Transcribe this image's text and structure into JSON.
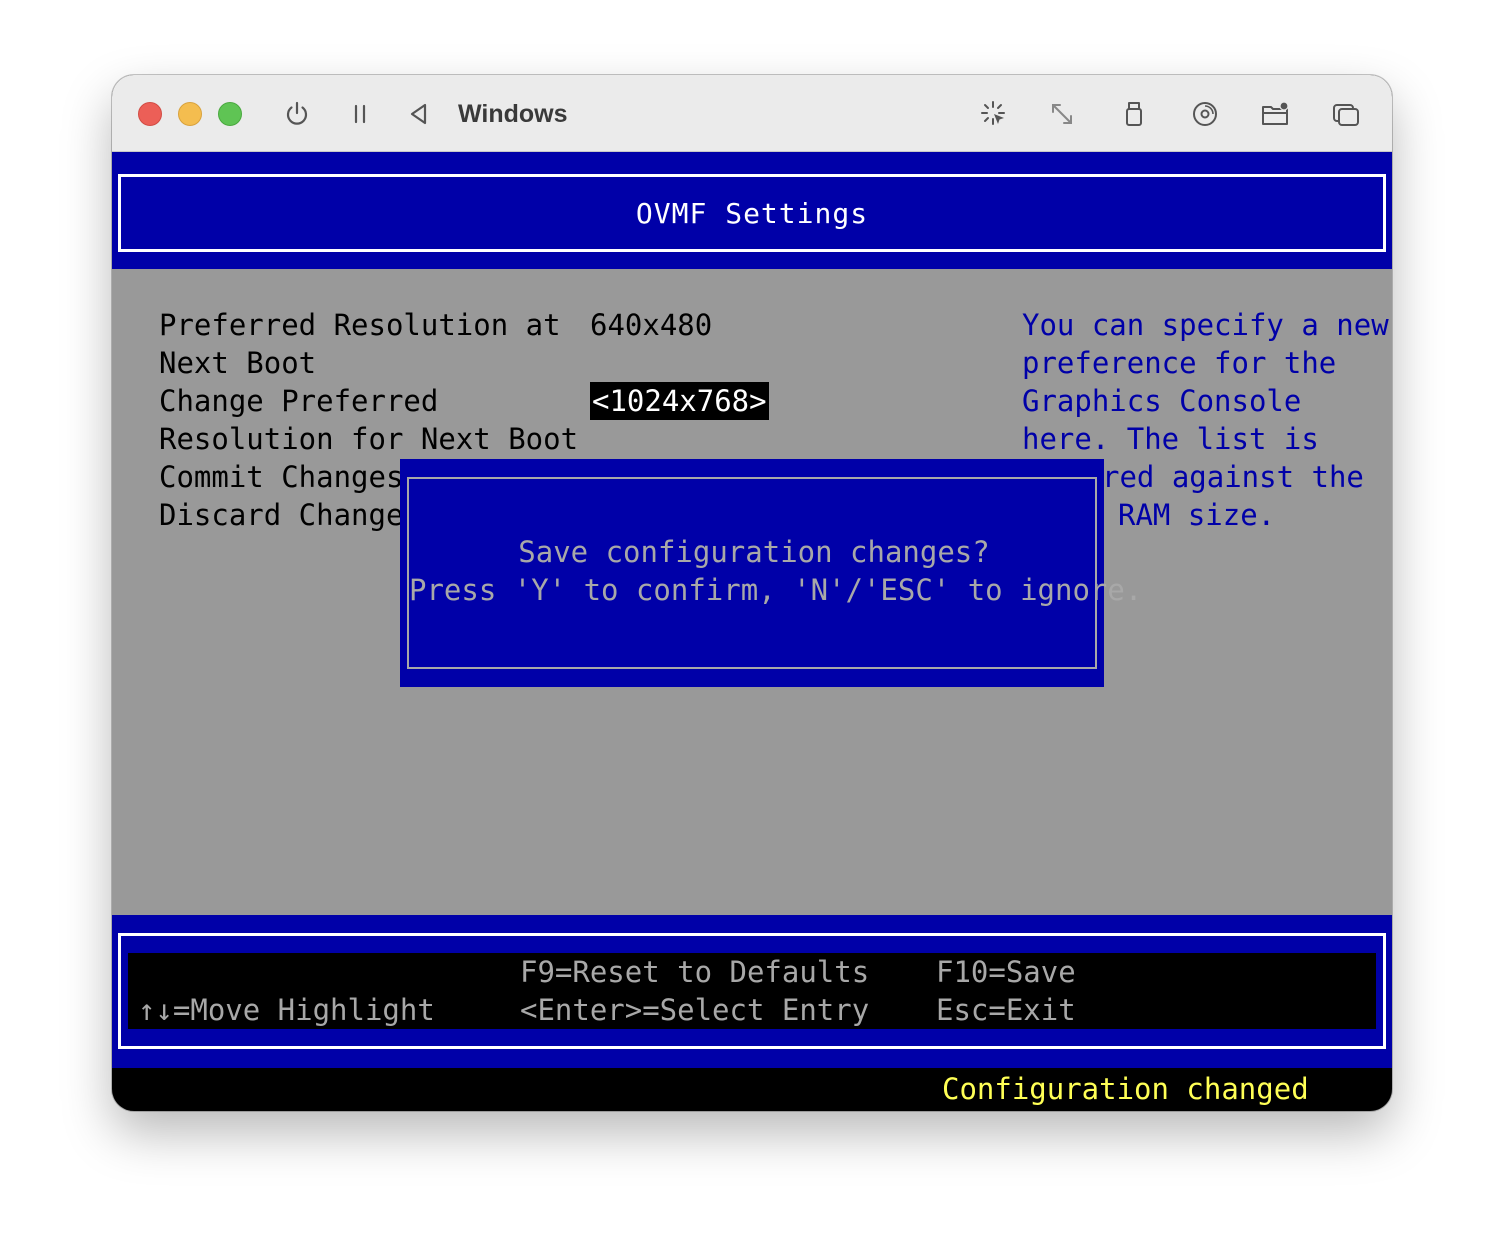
{
  "window": {
    "title": "Windows"
  },
  "titlebar_icons": [
    "power-icon",
    "pause-icon",
    "back-icon",
    "magic-cursor-icon",
    "resize-icon",
    "usb-icon",
    "disc-icon",
    "shared-folder-icon",
    "windows-overlay-icon"
  ],
  "bios": {
    "header_title": "OVMF Settings",
    "options": {
      "resolution_label_1": "Preferred Resolution at",
      "resolution_label_2": "Next Boot",
      "resolution_value": "640x480",
      "change_label_1": "Change Preferred",
      "change_label_2": "Resolution for Next Boot",
      "change_value": "<1024x768>",
      "commit_label": "Commit Changes",
      "discard_label": "Discard Changes"
    },
    "help": {
      "line1": "You can specify a new",
      "line2": "preference for the",
      "line3": "Graphics Console",
      "line4": "here. The list is",
      "line5": "red against the",
      "line6": "RAM size."
    },
    "dialog": {
      "line1": "Save configuration changes?",
      "line2": "Press 'Y' to confirm, 'N'/'ESC' to ignore."
    },
    "footer": {
      "move": "↑↓=Move Highlight",
      "reset": "F9=Reset to Defaults",
      "select": "<Enter>=Select Entry",
      "save": "F10=Save",
      "exit": "Esc=Exit"
    },
    "status": "Configuration changed"
  },
  "colors": {
    "bios_blue": "#0000a8",
    "bios_gray": "#999999",
    "dialog_text": "#a8a8a8",
    "status_yellow": "#ffff55",
    "close": "#ec5f57",
    "minimize": "#f4bd4f",
    "maximize": "#5fc454"
  }
}
